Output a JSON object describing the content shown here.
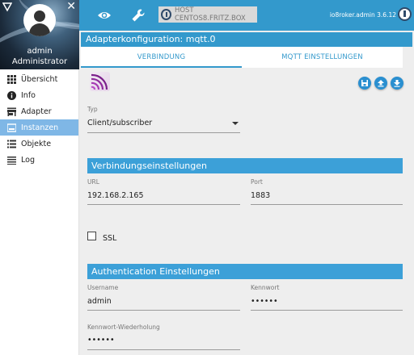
{
  "sidebar": {
    "user": {
      "name": "admin",
      "role": "Administrator"
    },
    "items": [
      {
        "label": "Übersicht",
        "icon": "grid-icon"
      },
      {
        "label": "Info",
        "icon": "info-icon"
      },
      {
        "label": "Adapter",
        "icon": "store-icon"
      },
      {
        "label": "Instanzen",
        "icon": "instances-icon"
      },
      {
        "label": "Objekte",
        "icon": "list-icon"
      },
      {
        "label": "Log",
        "icon": "lines-icon"
      }
    ],
    "active_item": "Instanzen"
  },
  "topbar": {
    "host": "HOST CENTOS8.FRITZ.BOX",
    "version": "io8roker.admin 3.6.12"
  },
  "dialog": {
    "title": "Adapterkonfiguration: mqtt.0",
    "tabs": [
      {
        "label": "VERBINDUNG",
        "active": true
      },
      {
        "label": "MQTT EINSTELLUNGEN",
        "active": false
      }
    ],
    "type": {
      "label": "Typ",
      "value": "Client/subscriber"
    },
    "connection_section": "Verbindungseinstellungen",
    "url": {
      "label": "URL",
      "value": "192.168.2.165"
    },
    "port": {
      "label": "Port",
      "value": "1883"
    },
    "ssl": {
      "label": "SSL",
      "checked": false
    },
    "auth_section": "Authentication Einstellungen",
    "username": {
      "label": "Username",
      "value": "admin"
    },
    "password": {
      "label": "Kennwort",
      "value": "••••••"
    },
    "password_repeat": {
      "label": "Kennwort-Wiederholung",
      "value": "••••••"
    }
  },
  "colors": {
    "accent": "#3399cc",
    "section": "#3ca0d8",
    "active_nav": "#7fb7e6",
    "action_button": "#2a8fd0"
  }
}
